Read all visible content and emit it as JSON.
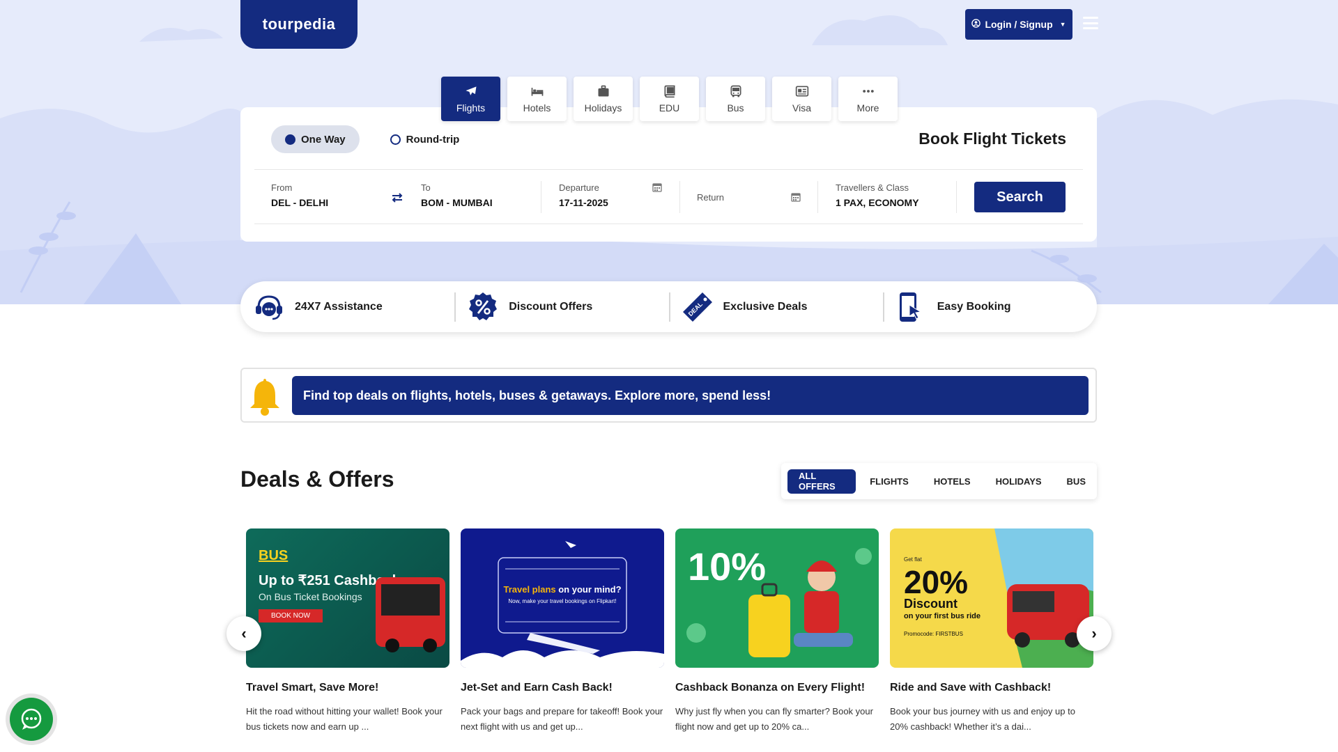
{
  "brand": {
    "name": "tourpedia"
  },
  "header": {
    "login_label": "Login / Signup"
  },
  "tabs": [
    {
      "label": "Flights",
      "icon": "plane-icon",
      "active": true
    },
    {
      "label": "Hotels",
      "icon": "bed-icon",
      "active": false
    },
    {
      "label": "Holidays",
      "icon": "suitcase-icon",
      "active": false
    },
    {
      "label": "EDU",
      "icon": "book-icon",
      "active": false
    },
    {
      "label": "Bus",
      "icon": "bus-icon",
      "active": false
    },
    {
      "label": "Visa",
      "icon": "id-card-icon",
      "active": false
    },
    {
      "label": "More",
      "icon": "more-dots-icon",
      "active": false
    }
  ],
  "search": {
    "trip_types": [
      "One Way",
      "Round-trip"
    ],
    "selected_trip": "One Way",
    "title": "Book Flight Tickets",
    "from": {
      "label": "From",
      "value": "DEL - DELHI"
    },
    "to": {
      "label": "To",
      "value": "BOM - MUMBAI"
    },
    "departure": {
      "label": "Departure",
      "value": "17-11-2025"
    },
    "return": {
      "label": "Return",
      "value": ""
    },
    "travellers": {
      "label": "Travellers & Class",
      "value": "1 PAX, ECONOMY"
    },
    "button": "Search"
  },
  "features": [
    {
      "label": "24X7 Assistance",
      "icon": "support-agent-icon"
    },
    {
      "label": "Discount Offers",
      "icon": "discount-badge-icon"
    },
    {
      "label": "Exclusive Deals",
      "icon": "deal-tag-icon"
    },
    {
      "label": "Easy Booking",
      "icon": "phone-tap-icon"
    }
  ],
  "notice": {
    "text": "Find top deals on flights, hotels, buses & getaways. Explore more, spend less!"
  },
  "deals": {
    "title": "Deals & Offers",
    "filters": [
      "ALL OFFERS",
      "FLIGHTS",
      "HOTELS",
      "HOLIDAYS",
      "BUS"
    ],
    "active_filter": "ALL OFFERS",
    "cards": [
      {
        "title": "Travel Smart, Save More!",
        "desc": "Hit the road without hitting your wallet! Book your bus tickets now and earn up ...",
        "banner": {
          "tag": "BUS",
          "headline": "Up to ₹251 Cashback",
          "sub": "On Bus Ticket Bookings",
          "cta": "BOOK NOW"
        }
      },
      {
        "title": "Jet-Set and Earn Cash Back!",
        "desc": "Pack your bags and prepare for takeoff! Book your next flight with us and get up...",
        "banner": {
          "headline_a": "Travel plans",
          "headline_b": " on your mind?",
          "sub": "Now, make your travel bookings on Flipkart!"
        }
      },
      {
        "title": "Cashback Bonanza on Every Flight!",
        "desc": "Why just fly when you can fly smarter? Book your flight now and get up to 20% ca...",
        "banner": {
          "headline": "10%"
        }
      },
      {
        "title": "Ride and Save with Cashback!",
        "desc": "Book your bus journey with us and enjoy up to 20% cashback! Whether it’s a dai...",
        "banner": {
          "pre": "Get flat",
          "headline": "20%",
          "mid": "Discount",
          "sub": "on your first bus ride",
          "promo": "Promocode: FIRSTBUS"
        }
      }
    ]
  },
  "colors": {
    "primary": "#142b80",
    "hero_bg": "#e6ebfb",
    "accent_yellow": "#f5b50a",
    "chat_green": "#159a3f"
  }
}
